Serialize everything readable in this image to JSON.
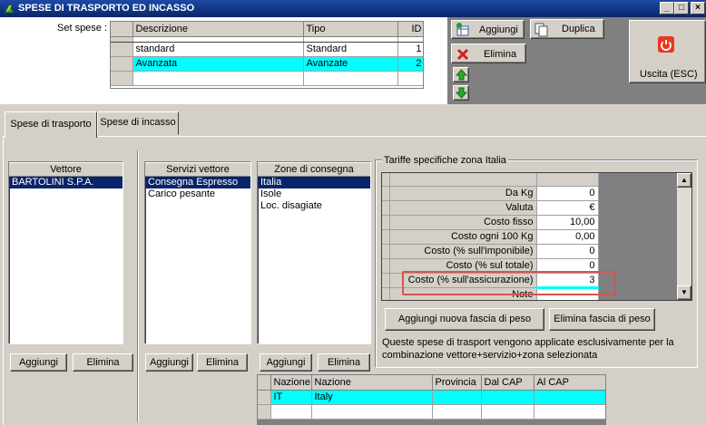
{
  "window": {
    "title": "SPESE DI TRASPORTO ED INCASSO",
    "minimize": "_",
    "maximize": "□",
    "close": "×"
  },
  "set_spese": {
    "label": "Set spese :",
    "columns": [
      "Descrizione",
      "Tipo",
      "ID"
    ],
    "rows": [
      {
        "descrizione": "standard",
        "tipo": "Standard",
        "id": "1"
      },
      {
        "descrizione": "Avanzata",
        "tipo": "Avanzate",
        "id": "2"
      }
    ]
  },
  "actions": {
    "aggiungi": "Aggiungi",
    "duplica": "Duplica",
    "elimina": "Elimina",
    "uscita": "Uscita (ESC)"
  },
  "tabs": [
    "Spese di trasporto",
    "Spese di incasso"
  ],
  "vettore": {
    "header": "Vettore",
    "items": [
      "BARTOLINI S.P.A."
    ],
    "add": "Aggiungi",
    "remove": "Elimina"
  },
  "servizi": {
    "header": "Servizi vettore",
    "items": [
      "Consegna Espresso",
      "Carico pesante"
    ],
    "add": "Aggiungi",
    "remove": "Elimina"
  },
  "zone": {
    "header": "Zone di consegna",
    "items": [
      "Italia",
      "Isole",
      "Loc. disagiate"
    ],
    "add": "Aggiungi",
    "remove": "Elimina"
  },
  "tariffe": {
    "title": "Tariffe specifiche zona Italia",
    "rows": [
      {
        "key": "Da Kg",
        "value": "0"
      },
      {
        "key": "Valuta",
        "value": "€"
      },
      {
        "key": "Costo fisso",
        "value": "10,00"
      },
      {
        "key": "Costo ogni 100 Kg",
        "value": "0,00"
      },
      {
        "key": "Costo (% sull'imponibile)",
        "value": "0"
      },
      {
        "key": "Costo (% sul totale)",
        "value": "0"
      },
      {
        "key": "Costo (% sull'assicurazione)",
        "value": "3"
      },
      {
        "key": "Note",
        "value": ""
      }
    ],
    "add_band": "Aggiungi nuova fascia di peso",
    "remove_band": "Elimina fascia di peso",
    "note": "Queste spese di trasport vengono applicate esclusivamente per la combinazione vettore+servizio+zona selezionata"
  },
  "nazioni": {
    "columns": [
      "Nazione",
      "Nazione",
      "Provincia",
      "Dal CAP",
      "Al CAP"
    ],
    "rows": [
      {
        "code": "IT",
        "name": "Italy",
        "provincia": "",
        "dal": "",
        "al": ""
      }
    ]
  },
  "colors": {
    "selection_cyan": "#00ffff",
    "list_selection": "#0a246a",
    "highlight_border": "#d9534f",
    "uscita_icon": "#e8391e"
  },
  "icons": {
    "aggiungi": "table-add-icon",
    "duplica": "copy-icon",
    "elimina": "red-x-icon",
    "up": "green-up-arrow-icon",
    "down": "green-down-arrow-icon",
    "uscita": "power-icon"
  }
}
